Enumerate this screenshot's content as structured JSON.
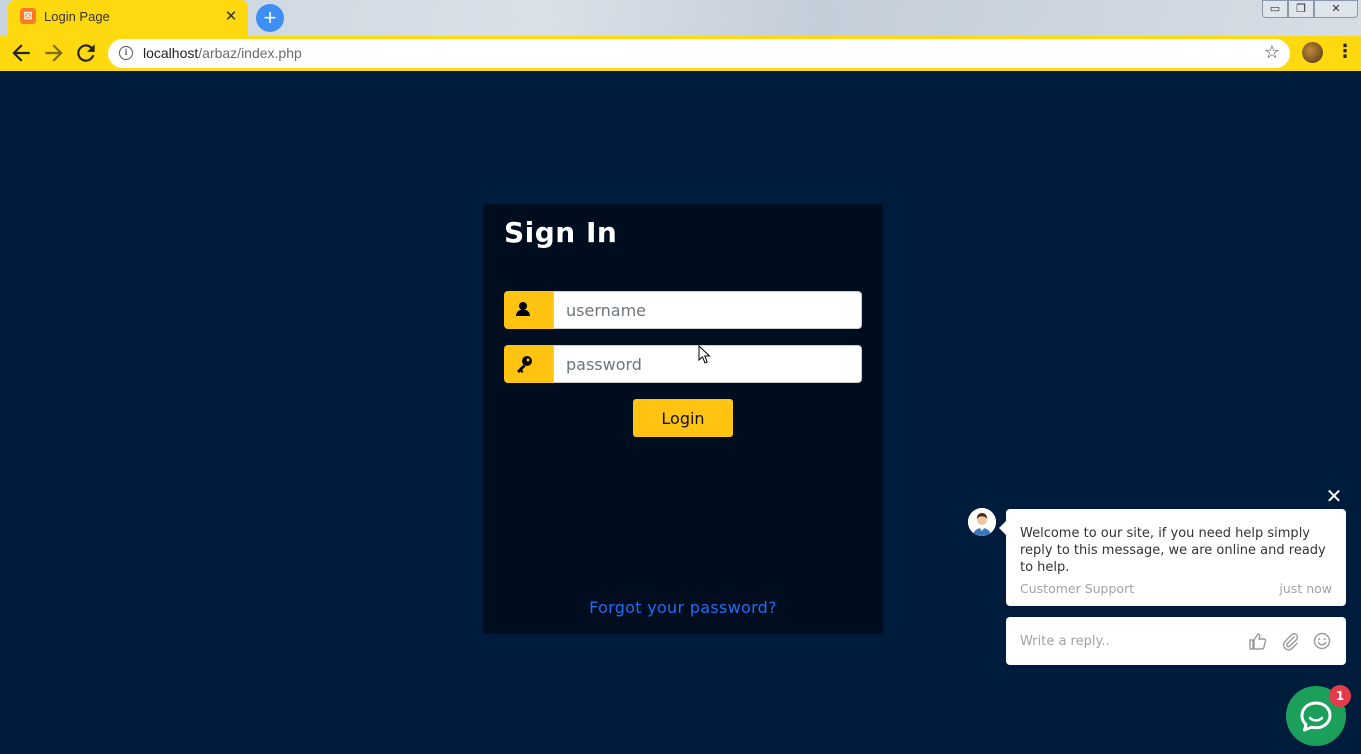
{
  "browser": {
    "tab_title": "Login Page",
    "tab_close": "✕",
    "new_tab": "+",
    "url_host": "localhost",
    "url_path": "/arbaz/index.php",
    "window_controls": {
      "minimize": "▭",
      "maximize": "❐",
      "close": "✕"
    }
  },
  "login": {
    "title": "Sign In",
    "username_placeholder": "username",
    "password_placeholder": "password",
    "login_label": "Login",
    "forgot_label": "Forgot your password?"
  },
  "chat": {
    "close": "✕",
    "message": "Welcome to our site, if you need help simply reply to this message, we are online and ready to help.",
    "sender": "Customer Support",
    "time": "just now",
    "reply_placeholder": "Write a reply..",
    "unread_count": "1"
  },
  "colors": {
    "page_bg": "#001c3c",
    "card_bg": "#000d1e",
    "accent": "#ffc312",
    "browser_theme": "#ffd910",
    "link": "#1e6cf3",
    "chat_launcher": "#1b9f5a",
    "badge": "#e53b4a"
  },
  "icons": {
    "username_field": "user-icon",
    "password_field": "key-icon",
    "reply_actions": [
      "thumbs-up-icon",
      "paperclip-icon",
      "smile-icon"
    ],
    "launcher": "chat-bubble-icon"
  }
}
